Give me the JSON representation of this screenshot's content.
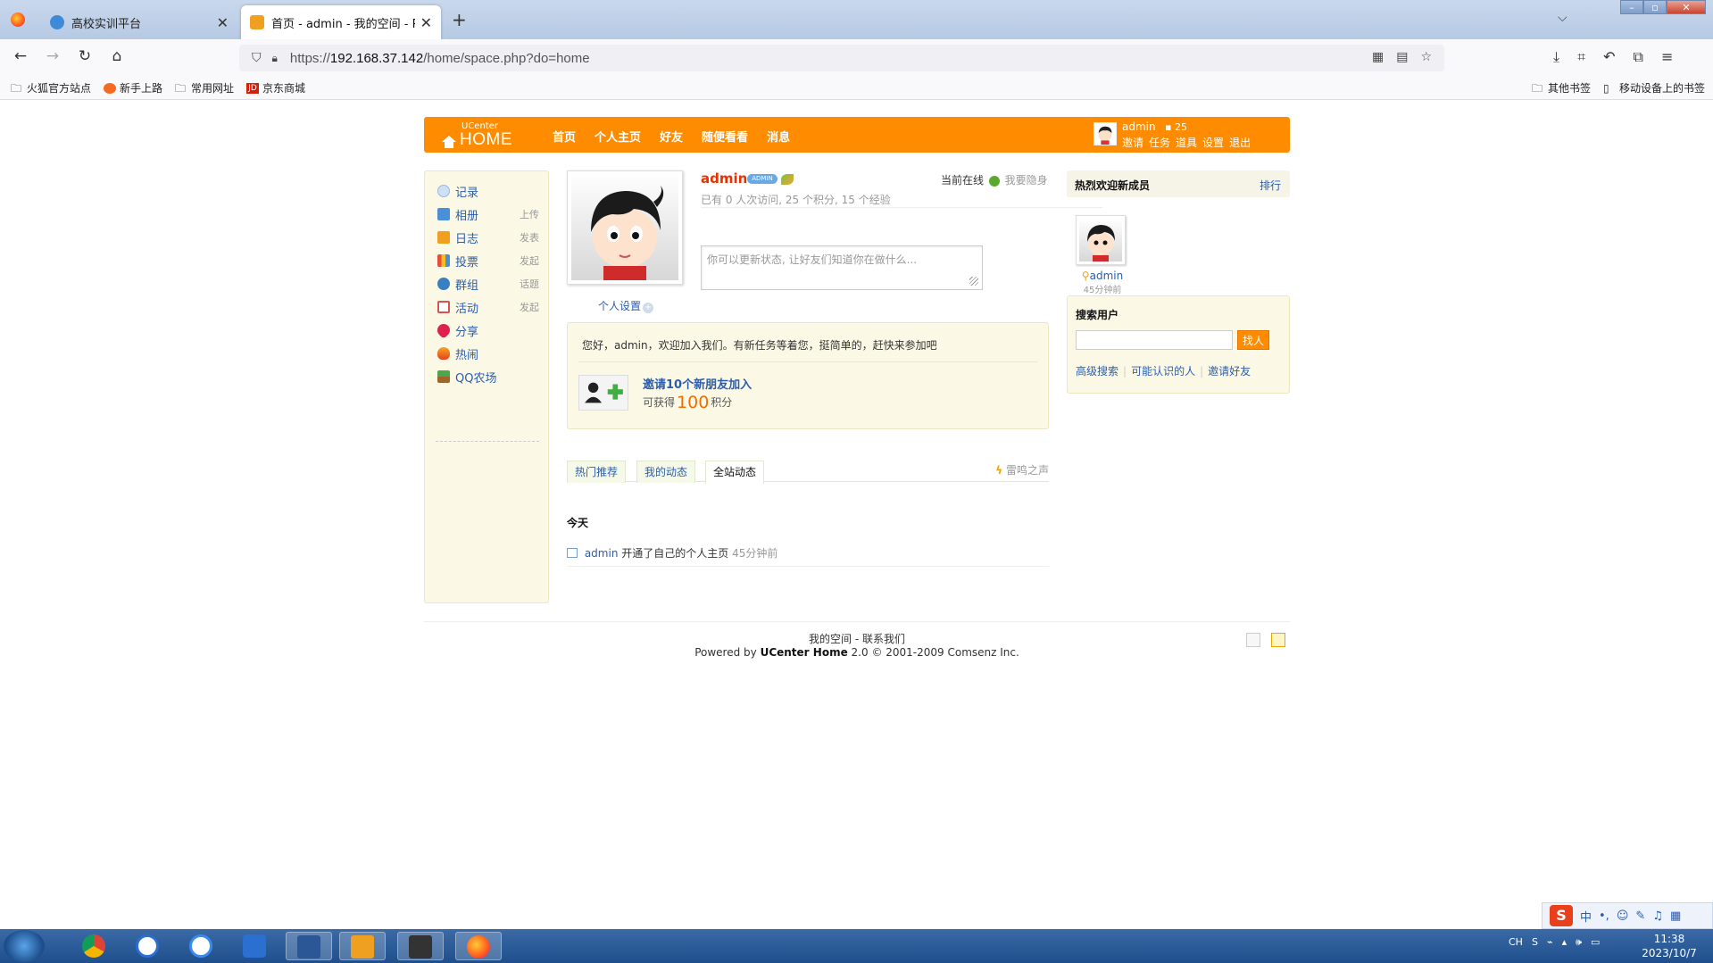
{
  "browser": {
    "tabs": [
      {
        "title": "高校实训平台",
        "active": false
      },
      {
        "title": "首页 - admin - 我的空间 - Pow",
        "active": true
      }
    ],
    "url_prefix": "https://",
    "url_host": "192.168.37.142",
    "url_path": "/home/space.php?do=home",
    "bookmarks": [
      "火狐官方站点",
      "新手上路",
      "常用网址",
      "京东商城"
    ],
    "bookmarks_right": [
      "其他书签",
      "移动设备上的书签"
    ]
  },
  "header": {
    "logo_small": "UCenter",
    "logo_big": "HOME",
    "nav": [
      "首页",
      "个人主页",
      "好友",
      "随便看看",
      "消息"
    ],
    "user": "admin",
    "points": "25",
    "user_links": [
      "邀请",
      "任务",
      "道具",
      "设置",
      "退出"
    ]
  },
  "sidebar": {
    "items": [
      {
        "label": "记录",
        "action": "",
        "color": "#9ab8e0"
      },
      {
        "label": "相册",
        "action": "上传",
        "color": "#4a90d9"
      },
      {
        "label": "日志",
        "action": "发表",
        "color": "#f0a020"
      },
      {
        "label": "投票",
        "action": "发起",
        "color": "#e84c3d"
      },
      {
        "label": "群组",
        "action": "话题",
        "color": "#3a7fc1"
      },
      {
        "label": "活动",
        "action": "发起",
        "color": "#d9534f"
      },
      {
        "label": "分享",
        "action": "",
        "color": "#e0204f"
      },
      {
        "label": "热闹",
        "action": "",
        "color": "#e8581a"
      },
      {
        "label": "QQ农场",
        "action": "",
        "color": "#4ca64c"
      }
    ]
  },
  "profile": {
    "name": "admin",
    "badge": "ADMIN",
    "online": "当前在线",
    "hide": "我要隐身",
    "stats": "已有 0 人次访问, 25 个积分, 15 个经验",
    "status_placeholder": "你可以更新状态, 让好友们知道你在做什么...",
    "settings": "个人设置"
  },
  "task": {
    "message": "您好，admin，欢迎加入我们。有新任务等着您，挺简单的，赶快来参加吧",
    "link": "邀请10个新朋友加入",
    "reward_prefix": "可获得",
    "reward_value": "100",
    "reward_suffix": "积分"
  },
  "feed_tabs": [
    "热门推荐",
    "我的动态",
    "全站动态"
  ],
  "thunder": "雷鸣之声",
  "feed": {
    "day": "今天",
    "user": "admin",
    "action": "开通了自己的个人主页",
    "time": "45分钟前"
  },
  "right": {
    "new_title": "热烈欢迎新成员",
    "rank": "排行",
    "member_name": "admin",
    "member_time": "45分钟前",
    "search_title": "搜索用户",
    "search_btn": "找人",
    "links": [
      "高级搜索",
      "可能认识的人",
      "邀请好友"
    ]
  },
  "footer": {
    "line1": "我的空间 - 联系我们",
    "powered": "Powered by",
    "product": "UCenter Home",
    "rest": "2.0 © 2001-2009 Comsenz Inc."
  },
  "ime": {
    "label": "中"
  },
  "taskbar": {
    "lang": "CH",
    "time": "11:38",
    "date": "2023/10/7"
  }
}
